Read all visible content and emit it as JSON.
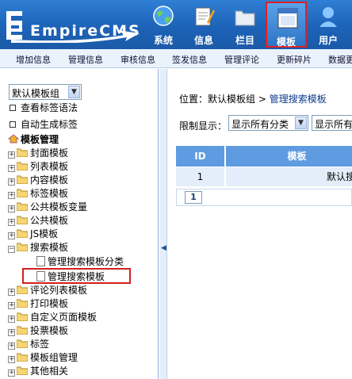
{
  "header": {
    "logo": "EmpireCMS",
    "nav": [
      {
        "label": "系统",
        "icon": "globe-icon"
      },
      {
        "label": "信息",
        "icon": "notepad-icon"
      },
      {
        "label": "栏目",
        "icon": "folder-icon"
      },
      {
        "label": "模板",
        "icon": "window-icon"
      },
      {
        "label": "用户",
        "icon": "user-icon"
      }
    ]
  },
  "submenu": [
    "增加信息",
    "管理信息",
    "审核信息",
    "签发信息",
    "管理评论",
    "更新碎片",
    "数据更"
  ],
  "left": {
    "group_select": "默认模板组",
    "options": [
      "查看标签语法",
      "自动生成标签"
    ],
    "root": "模板管理",
    "tree": [
      {
        "label": "封面模板"
      },
      {
        "label": "列表模板"
      },
      {
        "label": "内容模板"
      },
      {
        "label": "标签模板"
      },
      {
        "label": "公共模板变量"
      },
      {
        "label": "公共模板"
      },
      {
        "label": "JS模板"
      },
      {
        "label": "搜索模板"
      },
      {
        "label": "管理搜索模板分类"
      },
      {
        "label": "管理搜索模板"
      },
      {
        "label": "评论列表模板"
      },
      {
        "label": "打印模板"
      },
      {
        "label": "自定义页面模板"
      },
      {
        "label": "投票模板"
      },
      {
        "label": "标签"
      },
      {
        "label": "模板组管理"
      },
      {
        "label": "其他相关"
      }
    ]
  },
  "right": {
    "crumb_prefix": "位置：",
    "crumb_group": "默认模板组",
    "crumb_sep": " > ",
    "crumb_current": "管理搜索模板",
    "filter_label": "限制显示：",
    "filter_select1": "显示所有分类",
    "filter_select2": "显示所有",
    "table_headers": [
      "ID",
      "模板"
    ],
    "rows": [
      [
        "1",
        "默认搜索"
      ]
    ],
    "page": "1"
  },
  "colors": {
    "header_blue": "#1d63b8",
    "highlight_red": "#d42020",
    "table_header": "#5f9be0",
    "row_bg": "#e4eefa"
  }
}
